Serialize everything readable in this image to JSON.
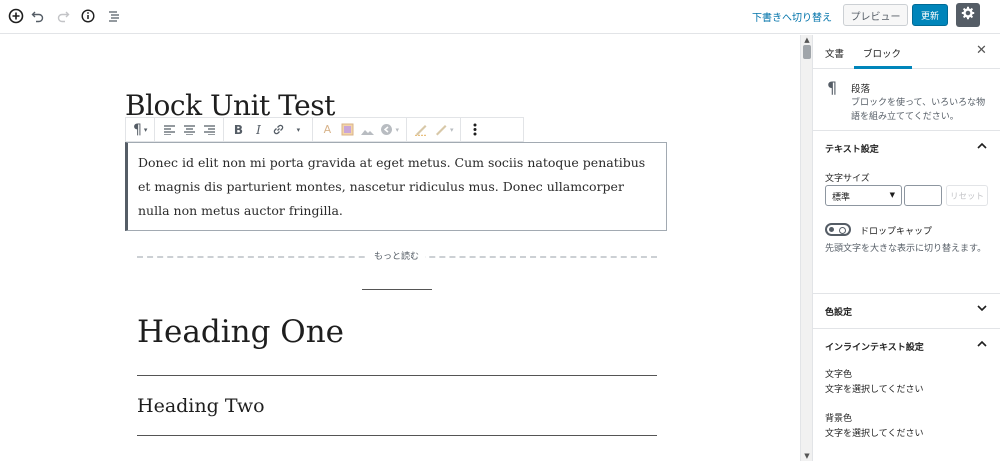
{
  "topbar": {
    "draft_link": "下書きへ切り替え",
    "preview_label": "プレビュー",
    "update_label": "更新",
    "icons": [
      "add-block-icon",
      "undo-icon",
      "redo-icon",
      "info-icon",
      "outline-icon",
      "gear-icon"
    ]
  },
  "editor": {
    "title": "Block Unit Test",
    "paragraph": "Donec id elit non mi porta gravida at eget metus. Cum sociis natoque penatibus et magnis dis parturient montes, nascetur ridiculus mus. Donec ullamcorper nulla non metus auctor fringilla.",
    "more_label": "もっと読む",
    "heading_one": "Heading One",
    "heading_two": "Heading Two"
  },
  "sidebar": {
    "tab_document": "文書",
    "tab_block": "ブロック",
    "active_tab": "ブロック",
    "block_card": {
      "title": "段落",
      "description": "ブロックを使って、いろいろな物語を組み立ててください。"
    },
    "text_settings": {
      "title": "テキスト設定",
      "font_size_label": "文字サイズ",
      "font_size_value": "標準",
      "reset_label": "リセット",
      "dropcap_label": "ドロップキャップ",
      "dropcap_help": "先頭文字を大きな表示に切り替えます。"
    },
    "color_settings": {
      "title": "色設定"
    },
    "inline_settings": {
      "title": "インラインテキスト設定",
      "text_color_label": "文字色",
      "text_color_hint": "文字を選択してください",
      "bg_color_label": "背景色",
      "bg_color_hint": "文字を選択してください"
    }
  },
  "colors": {
    "accent": "#0085ba",
    "link": "#0073aa"
  }
}
